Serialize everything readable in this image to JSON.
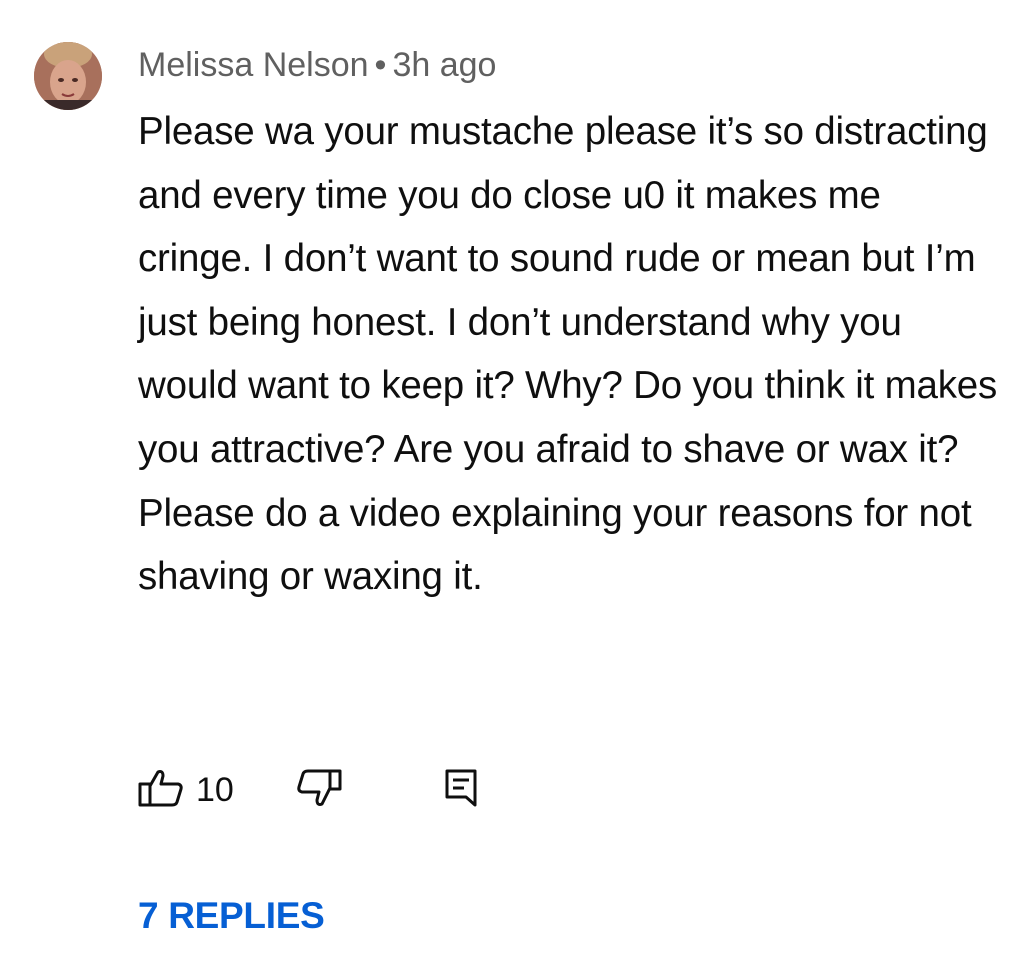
{
  "comment": {
    "author": "Melissa Nelson",
    "separator": "•",
    "time": "3h ago",
    "text": "Please wa your mustache please it’s so distracting and every time you do close u0 it makes me cringe. I don’t want to sound rude or mean but I’m just being honest. I don’t understand why you would want to keep it? Why? Do you think it makes you attractive? Are you afraid to shave or wax it? Please do a video explaining your reasons for not shaving or waxing it.",
    "like_count": "10",
    "replies_label": "7 REPLIES"
  },
  "icons": {
    "avatar": "avatar",
    "like": "thumbs-up-icon",
    "dislike": "thumbs-down-icon",
    "reply": "reply-comment-icon"
  },
  "colors": {
    "author_meta": "#606060",
    "text": "#0f0f0f",
    "replies_link": "#065fd4",
    "background": "#ffffff"
  }
}
